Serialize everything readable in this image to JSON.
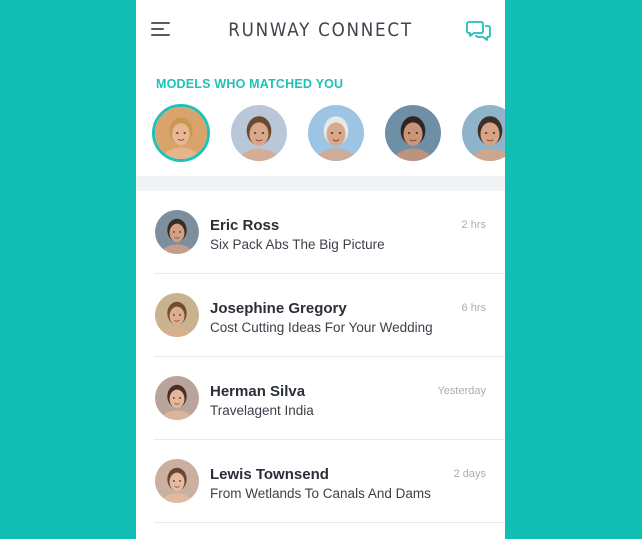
{
  "header": {
    "title": "RUNWAY CONNECT",
    "menu_icon": "hamburger-menu-icon",
    "chat_icon": "chat-bubbles-icon"
  },
  "matches": {
    "title": "MODELS WHO MATCHED YOU",
    "avatars": [
      {
        "label": "blonde woman smiling",
        "selected": true,
        "bg": "#d9a36b",
        "skin": "#e8b894",
        "hair": "#c89852"
      },
      {
        "label": "woman in sunglasses",
        "selected": false,
        "bg": "#b9c7d8",
        "skin": "#d9a78a",
        "hair": "#6b4a33"
      },
      {
        "label": "man in white cap",
        "selected": false,
        "bg": "#9ec4e4",
        "skin": "#d7a88c",
        "hair": "#e8e8e8"
      },
      {
        "label": "man with beard",
        "selected": false,
        "bg": "#6f8fa6",
        "skin": "#c99477",
        "hair": "#2e2520"
      },
      {
        "label": "smiling man",
        "selected": false,
        "bg": "#8fb4c9",
        "skin": "#d6a487",
        "hair": "#3d2f25"
      }
    ]
  },
  "conversations": [
    {
      "name": "Eric Ross",
      "message": "Six Pack Abs The Big Picture",
      "time": "2 hrs",
      "bg": "#7d8f9e",
      "skin": "#d2a085",
      "hair": "#3a2c22"
    },
    {
      "name": "Josephine Gregory",
      "message": "Cost Cutting Ideas For Your Wedding",
      "time": "6 hrs",
      "bg": "#c9b38f",
      "skin": "#dcae8e",
      "hair": "#6d4d35"
    },
    {
      "name": "Herman Silva",
      "message": "Travelagent India",
      "time": "Yesterday",
      "bg": "#b8a49a",
      "skin": "#e2b79e",
      "hair": "#4a2e22"
    },
    {
      "name": "Lewis Townsend",
      "message": "From Wetlands To Canals And Dams",
      "time": "2 days",
      "bg": "#c9b0a0",
      "skin": "#e6bba0",
      "hair": "#6a4630"
    }
  ],
  "colors": {
    "accent": "#20c1b6",
    "background": "#12bdb3"
  }
}
